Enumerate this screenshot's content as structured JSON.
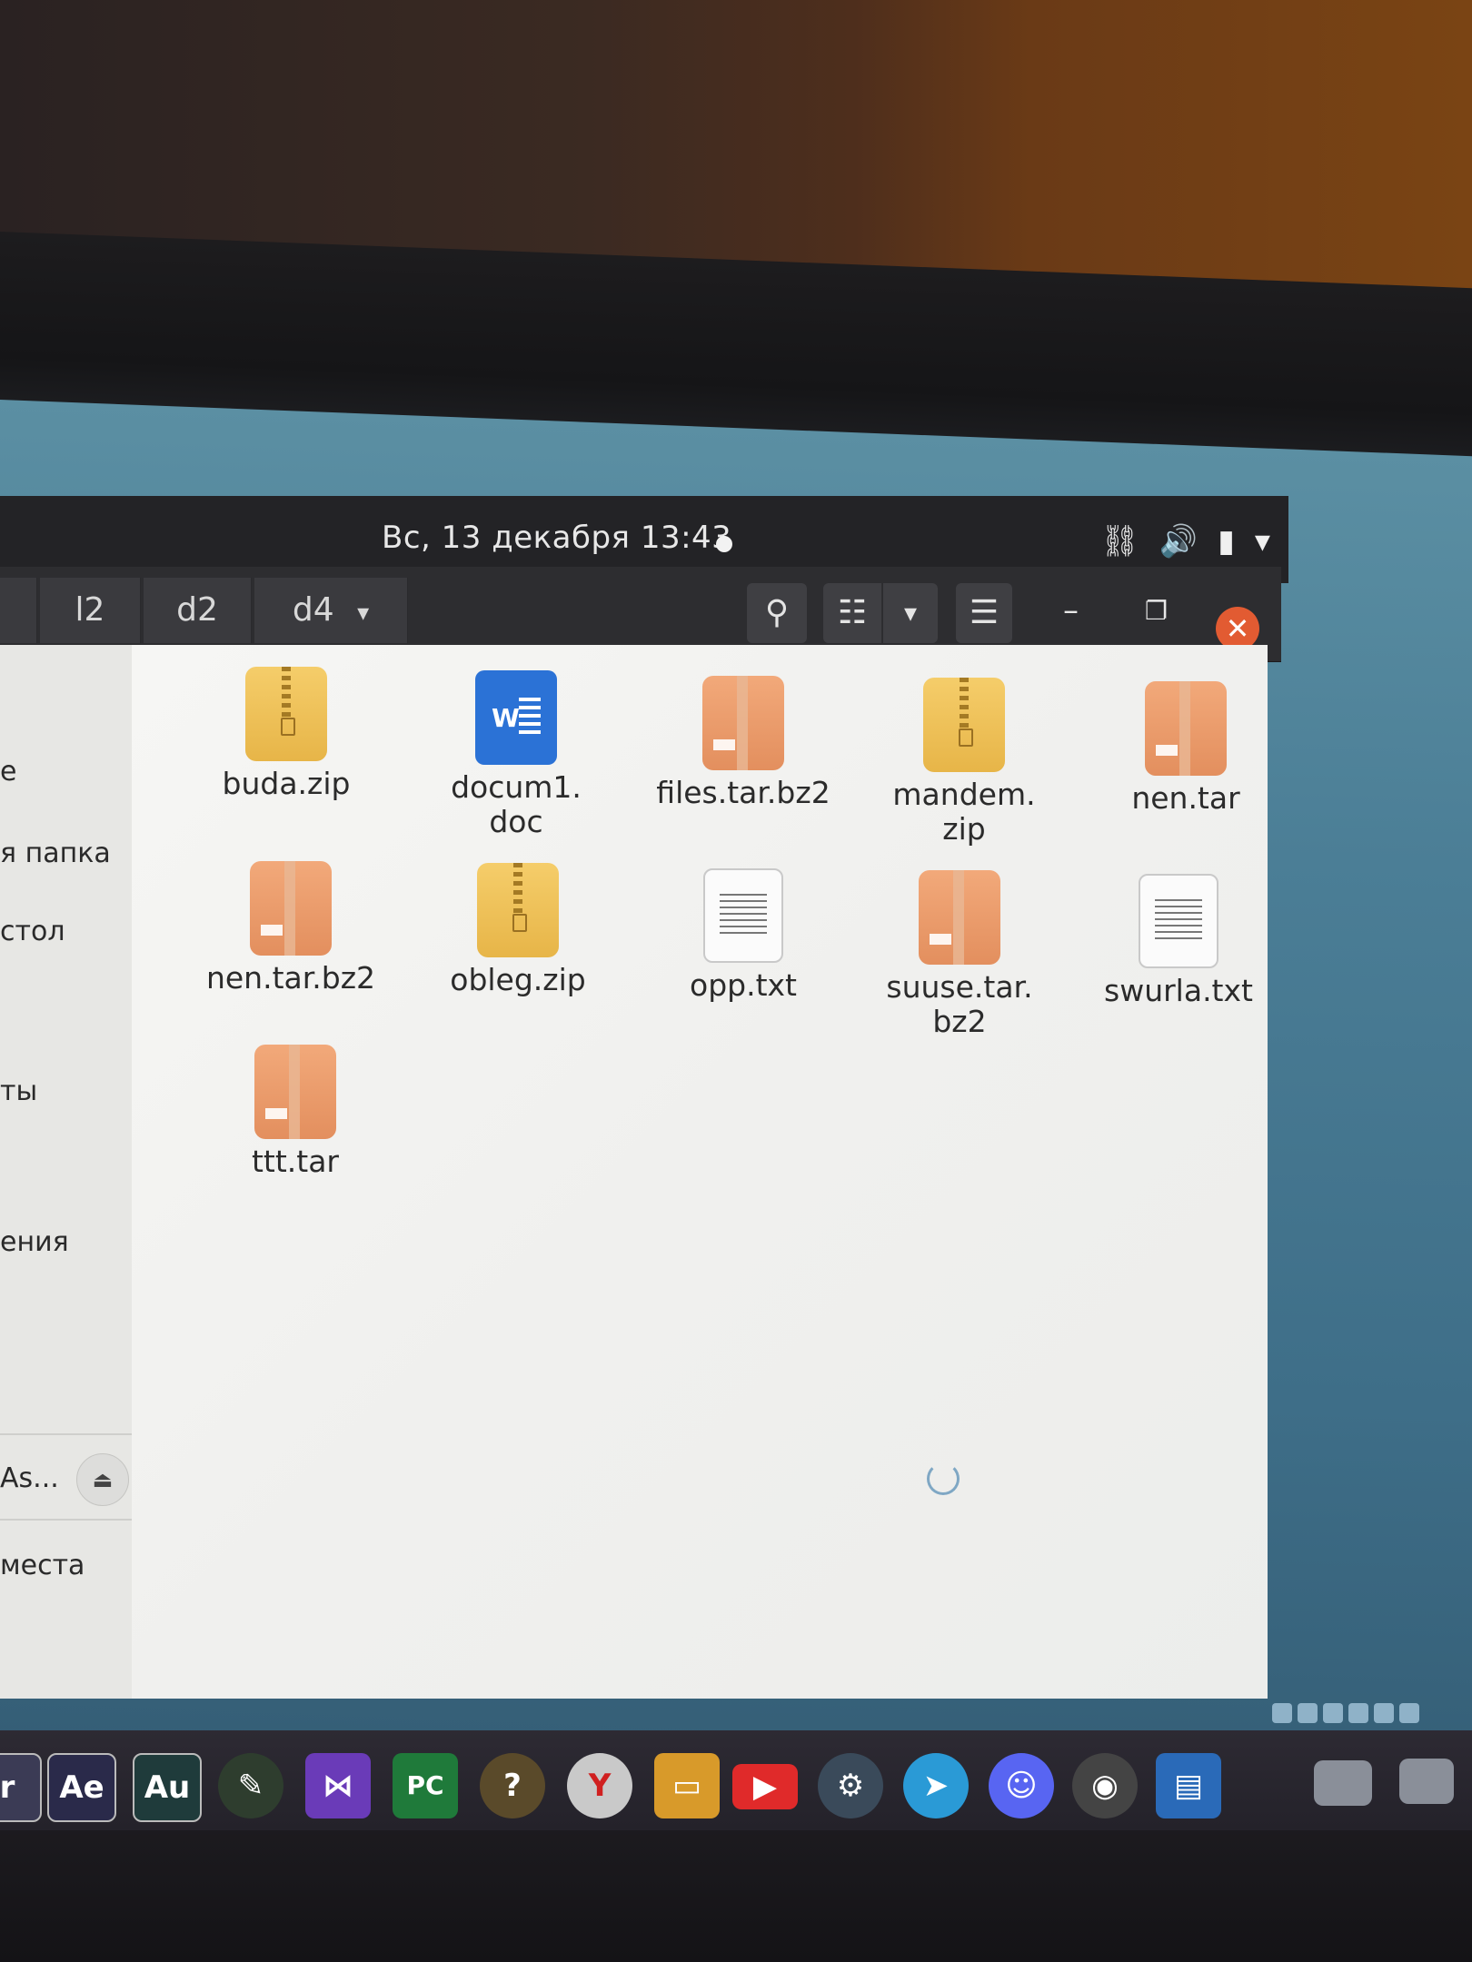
{
  "topbar": {
    "clock": "Вс, 13 декабря  13:43",
    "tray_icons": [
      "network-icon",
      "volume-icon",
      "battery-icon",
      "system-menu-chevron-icon"
    ],
    "tray_glyphs": {
      "network": "⛓",
      "volume": "🔊",
      "battery": "▮",
      "menu": "▾"
    }
  },
  "headerbar": {
    "breadcrumbs": [
      "l2",
      "d2",
      "d4"
    ],
    "dropdown_glyph": "▾",
    "search_glyph": "⚲",
    "list_glyph": "☷",
    "view_dropdown_glyph": "▾",
    "menu_glyph": "☰",
    "minimize_glyph": "–",
    "restore_glyph": "❐",
    "close_glyph": "✕"
  },
  "sidebar": {
    "items": [
      "е",
      "я папка",
      "стол",
      "ты",
      "ения",
      "As...",
      "места"
    ],
    "eject_glyph": "⏏"
  },
  "files": [
    {
      "name": "buda.zip",
      "type": "zip"
    },
    {
      "name": "docum1.\ndoc",
      "type": "doc"
    },
    {
      "name": "files.tar.bz2",
      "type": "tar"
    },
    {
      "name": "mandem.\nzip",
      "type": "zip"
    },
    {
      "name": "nen.tar",
      "type": "tar"
    },
    {
      "name": "nen.tar.bz2",
      "type": "tar"
    },
    {
      "name": "obleg.zip",
      "type": "zip"
    },
    {
      "name": "opp.txt",
      "type": "txt"
    },
    {
      "name": "suuse.tar.\nbz2",
      "type": "tar"
    },
    {
      "name": "swurla.txt",
      "type": "txt"
    },
    {
      "name": "ttt.tar",
      "type": "tar"
    }
  ],
  "taskbar": {
    "apps": [
      {
        "label": "r",
        "name": "app-partial-icon",
        "color": "#3b3b55"
      },
      {
        "label": "Ae",
        "name": "after-effects-icon",
        "color": "#2a2a4a"
      },
      {
        "label": "Au",
        "name": "audition-icon",
        "color": "#1f3b3b"
      },
      {
        "label": "✎",
        "name": "inkscape-icon",
        "color": "#2e3d2e"
      },
      {
        "label": "⋈",
        "name": "visual-studio-icon",
        "color": "#6a3bb8"
      },
      {
        "label": "PC",
        "name": "pycharm-icon",
        "color": "#1f7a3a"
      },
      {
        "label": "?",
        "name": "help-icon",
        "color": "#5a4a2a"
      },
      {
        "label": "Y",
        "name": "yandex-browser-icon",
        "color": "#c9c9c9"
      },
      {
        "label": "▭",
        "name": "file-manager-icon",
        "color": "#d89a2a"
      },
      {
        "label": "▶",
        "name": "youtube-icon",
        "color": "#e02a2a"
      },
      {
        "label": "⚙",
        "name": "steam-icon",
        "color": "#3a4a5a"
      },
      {
        "label": "➤",
        "name": "telegram-icon",
        "color": "#2a9ad6"
      },
      {
        "label": "☺",
        "name": "discord-icon",
        "color": "#5865f2"
      },
      {
        "label": "◉",
        "name": "davinci-resolve-icon",
        "color": "#444"
      },
      {
        "label": "▤",
        "name": "computer-icon",
        "color": "#2a6ab8"
      }
    ]
  }
}
